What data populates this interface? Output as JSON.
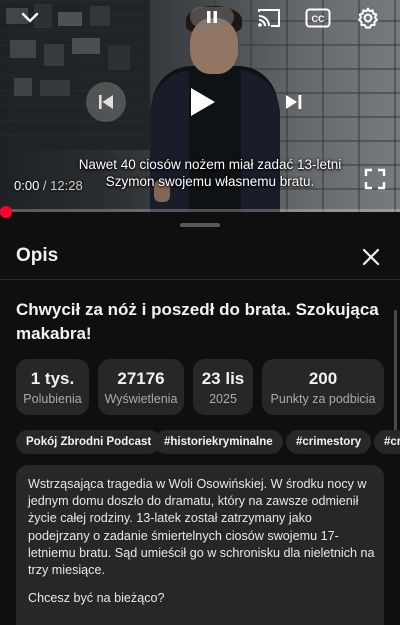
{
  "player": {
    "captions_line1": "Nawet 40 ciosów nożem miał zadać 13-letni",
    "captions_line2": "Szymon swojemu własnemu bratu.",
    "time_current": "0:00",
    "time_separator": " / ",
    "time_total": "12:28",
    "progress_fraction": 0.0,
    "icons": {
      "collapse": "chevron-down-icon",
      "pause": "pause-icon",
      "cast": "cast-icon",
      "captions": "closed-captions-icon",
      "settings": "gear-icon",
      "previous": "skip-previous-icon",
      "play": "play-icon",
      "next": "skip-next-icon",
      "fullscreen": "fullscreen-icon"
    },
    "colors": {
      "progress": "#ff0033"
    }
  },
  "sheet": {
    "title": "Opis",
    "close_icon": "close-icon",
    "video_title": "Chwycił za nóż i poszedł do brata. Szokująca makabra!",
    "stats": [
      {
        "value": "1 tys.",
        "label": "Polubienia"
      },
      {
        "value": "27176",
        "label": "Wyświetlenia"
      },
      {
        "value": "23 lis",
        "label": "2025"
      },
      {
        "value": "200",
        "label": "Punkty za podbicia"
      }
    ],
    "tags": [
      "Pokój Zbrodni Podcast",
      "#historiekryminalne",
      "#crimestory",
      "#crime"
    ],
    "description": "Wstrząsająca tragedia w Woli Osowińskiej. W środku nocy w jednym domu doszło do dramatu, który na zawsze odmienił życie całej rodziny. 13-latek został zatrzymany jako podejrzany o zadanie śmiertelnych ciosów swojemu 17-letniemu bratu. Sąd umieścił go w schronisku dla nieletnich na trzy miesiące.",
    "cta": "Chcesz być na bieżąco?"
  }
}
